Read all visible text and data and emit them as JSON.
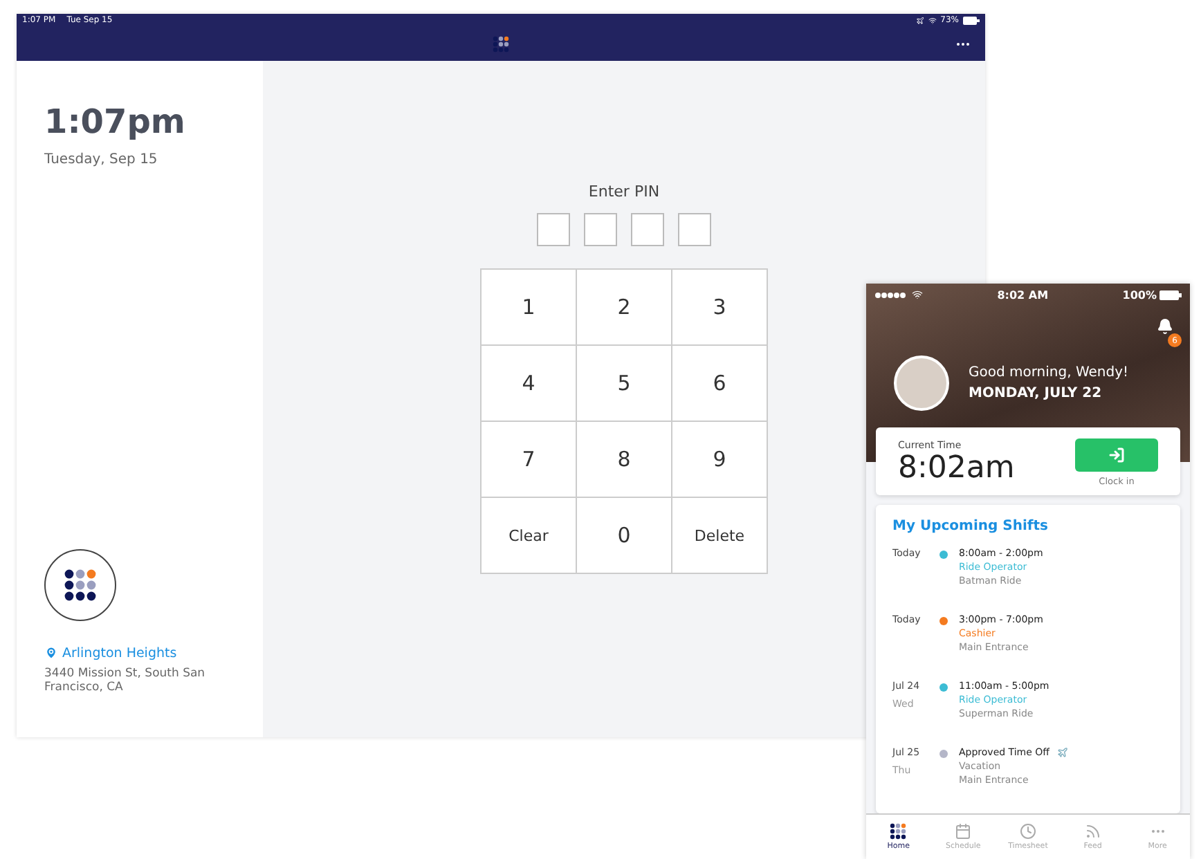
{
  "tablet": {
    "status_bar": {
      "time": "1:07 PM",
      "date": "Tue Sep 15",
      "battery": "73%"
    },
    "sidebar": {
      "time": "1:07pm",
      "date": "Tuesday, Sep 15",
      "location": "Arlington Heights",
      "address": "3440 Mission St, South San Francisco, CA"
    },
    "pin": {
      "title": "Enter PIN"
    },
    "keypad": [
      {
        "label": "1"
      },
      {
        "label": "2"
      },
      {
        "label": "3"
      },
      {
        "label": "4"
      },
      {
        "label": "5"
      },
      {
        "label": "6"
      },
      {
        "label": "7"
      },
      {
        "label": "8"
      },
      {
        "label": "9"
      },
      {
        "label": "Clear"
      },
      {
        "label": "0"
      },
      {
        "label": "Delete"
      }
    ]
  },
  "phone": {
    "status_bar": {
      "time": "8:02 AM",
      "battery": "100%"
    },
    "notifications": {
      "count": "6"
    },
    "greeting": "Good morning, Wendy!",
    "date": "MONDAY, JULY 22",
    "clock": {
      "label": "Current Time",
      "time": "8:02am",
      "button": "Clock in"
    },
    "shifts": {
      "title": "My Upcoming Shifts",
      "items": [
        {
          "kind": "shift",
          "date": "Today",
          "time": "8:00am - 2:00pm",
          "role": "Ride Operator",
          "place": "Batman Ride",
          "color": "#3cbcd4"
        },
        {
          "kind": "shift",
          "date": "Today",
          "time": "3:00pm - 7:00pm",
          "role": "Cashier",
          "place": "Main Entrance",
          "color": "#f47b20"
        },
        {
          "kind": "shift",
          "date": "Jul 24",
          "day": "Wed",
          "time": "11:00am - 5:00pm",
          "role": "Ride Operator",
          "place": "Superman Ride",
          "color": "#3cbcd4"
        },
        {
          "kind": "timeoff",
          "date": "Jul 25",
          "day": "Thu",
          "time": "Approved Time Off",
          "role": "Vacation",
          "place": "Main Entrance",
          "color": "#b4b6c8"
        }
      ]
    },
    "tabs": [
      {
        "label": "Home",
        "selected": true
      },
      {
        "label": "Schedule",
        "selected": false
      },
      {
        "label": "Timesheet",
        "selected": false
      },
      {
        "label": "Feed",
        "selected": false
      },
      {
        "label": "More",
        "selected": false
      }
    ]
  }
}
